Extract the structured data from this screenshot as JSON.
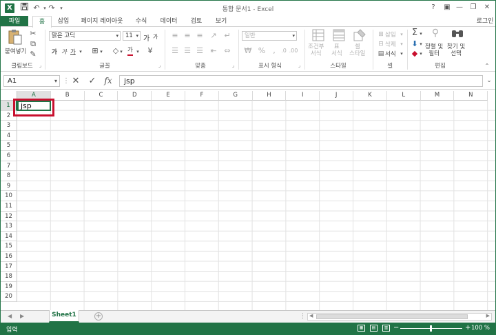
{
  "titlebar": {
    "logo": "X",
    "title": "통합 문서1 - Excel",
    "help": "?",
    "ribbon_display": "▣",
    "minimize": "—",
    "restore": "❐",
    "close": "✕",
    "icons": [
      "save-icon",
      "undo-icon",
      "redo-icon",
      "customize-qat-icon"
    ]
  },
  "tabs": {
    "file": "파일",
    "home": "홈",
    "insert": "삽입",
    "page_layout": "페이지 레이아웃",
    "formulas": "수식",
    "data": "데이터",
    "review": "검토",
    "view": "보기",
    "login": "로그인"
  },
  "ribbon": {
    "clipboard": {
      "paste": "붙여넣기",
      "label": "클립보드"
    },
    "font": {
      "name": "맑은 고딕",
      "size": "11",
      "grow": "가",
      "shrink": "가",
      "bold": "가",
      "italic": "가",
      "underline": "가",
      "font_color": "가",
      "label": "글꼴"
    },
    "alignment": {
      "label": "맞춤"
    },
    "number": {
      "format": "일반",
      "label": "표시 형식"
    },
    "styles": {
      "conditional": "조건부\n서식",
      "table": "표\n서식",
      "cell": "셀\n스타일",
      "label": "스타일"
    },
    "cells": {
      "insert": "삽입",
      "delete": "삭제",
      "format": "서식",
      "label": "셀"
    },
    "editing": {
      "sort": "정렬 및\n필터",
      "find": "찾기 및\n선택",
      "label": "편집"
    }
  },
  "formula_bar": {
    "name_box": "A1",
    "content": "jsp",
    "fx": "fx",
    "cancel": "✕",
    "enter": "✓"
  },
  "grid": {
    "columns": [
      "A",
      "B",
      "C",
      "D",
      "E",
      "F",
      "G",
      "H",
      "I",
      "J",
      "K",
      "L",
      "M",
      "N"
    ],
    "rows": [
      "1",
      "2",
      "3",
      "4",
      "5",
      "6",
      "7",
      "8",
      "9",
      "10",
      "11",
      "12",
      "13",
      "14",
      "15",
      "16",
      "17",
      "18",
      "19",
      "20"
    ],
    "a1_value": "jsp",
    "selected_cell": "A1"
  },
  "sheets": {
    "tabs": [
      "Sheet1"
    ],
    "add": "+"
  },
  "statusbar": {
    "mode": "입력",
    "zoom": "100 %",
    "zoom_minus": "−",
    "zoom_plus": "+"
  },
  "colors": {
    "accent": "#217346",
    "highlight": "#c8102e"
  }
}
